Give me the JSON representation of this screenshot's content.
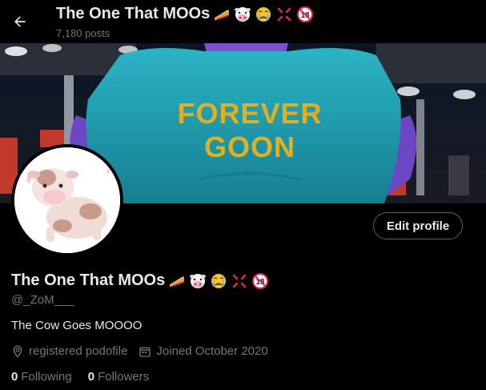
{
  "header": {
    "title": "The One That MOOs",
    "post_count": "7,180 posts"
  },
  "emojis": [
    "pie-emoji",
    "cow-face-emoji",
    "crying-face-emoji",
    "anger-symbol-emoji",
    "no-one-under-18-emoji"
  ],
  "age_badge": "18",
  "banner": {
    "shirt_line1": "FOREVER",
    "shirt_line2": "GOON"
  },
  "profile": {
    "edit_label": "Edit profile",
    "display_name": "The One That MOOs",
    "handle": "@_ZoM___",
    "bio": "The Cow Goes MOOOO",
    "location": "registered podofile",
    "joined": "Joined October 2020",
    "following_count": "0",
    "following_label": "Following",
    "followers_count": "0",
    "followers_label": "Followers"
  },
  "colors": {
    "background": "#000000",
    "text_primary": "#e7e9ea",
    "text_secondary": "#71767b",
    "shirt_teal": "#1f9fb0",
    "shirt_text": "#e0b020",
    "skin_purple": "#7b4fd0"
  }
}
